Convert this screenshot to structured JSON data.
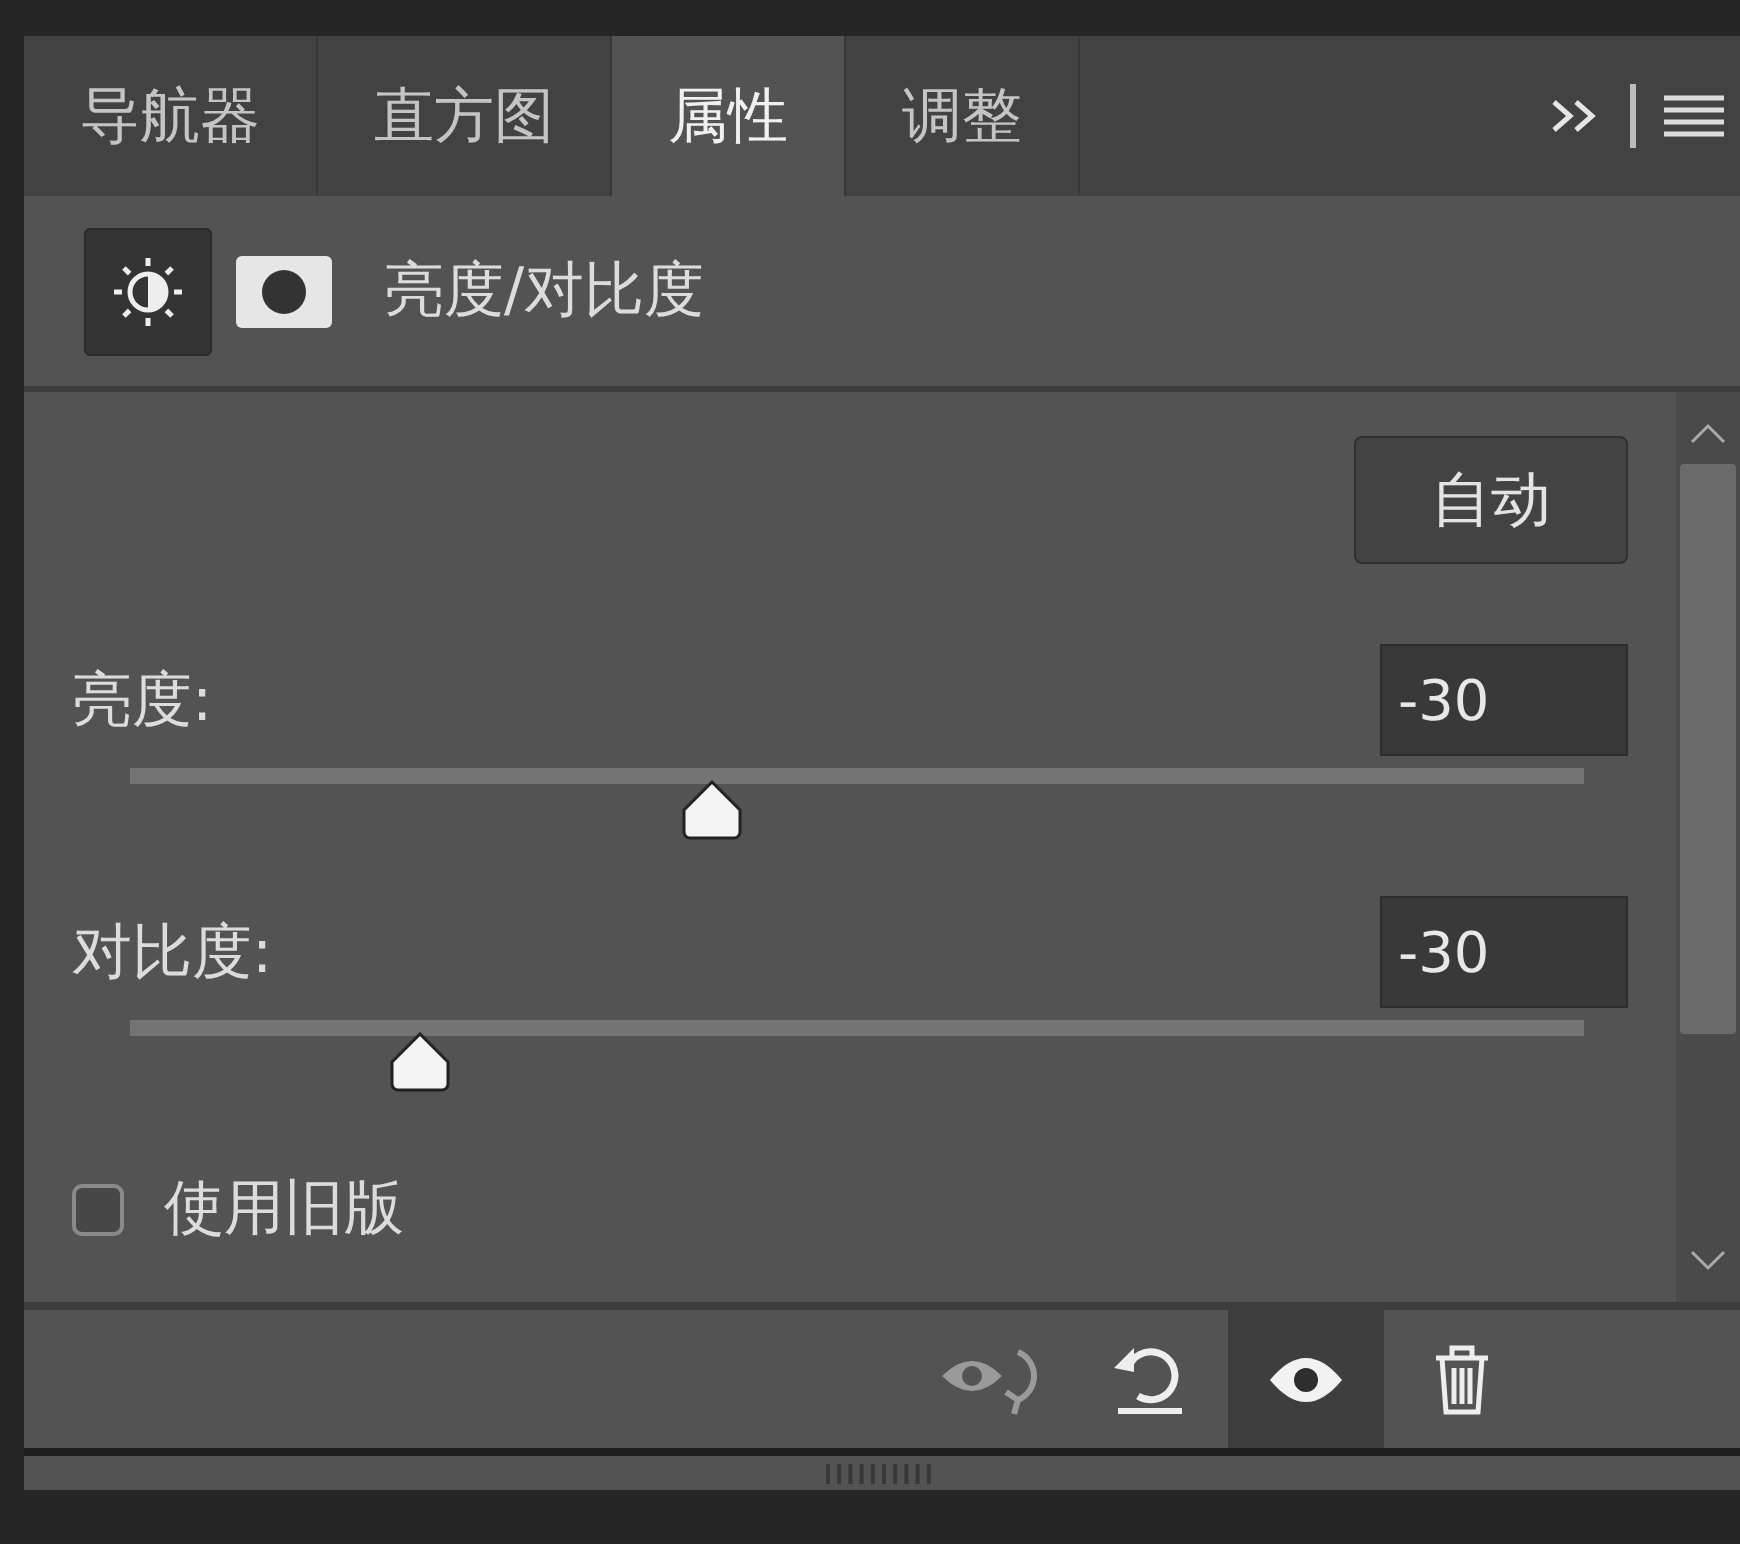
{
  "tabs": [
    {
      "label": "导航器",
      "selected": false
    },
    {
      "label": "直方图",
      "selected": false
    },
    {
      "label": "属性",
      "selected": true
    },
    {
      "label": "调整",
      "selected": false
    }
  ],
  "header": {
    "title": "亮度/对比度"
  },
  "auto_button": "自动",
  "sliders": [
    {
      "label": "亮度:",
      "value": "-30",
      "level": 0.4
    },
    {
      "label": "对比度:",
      "value": "-30",
      "level": 0.2
    }
  ],
  "legacy": {
    "label": "使用旧版",
    "checked": false
  },
  "footer": {
    "visibility_on": true
  }
}
